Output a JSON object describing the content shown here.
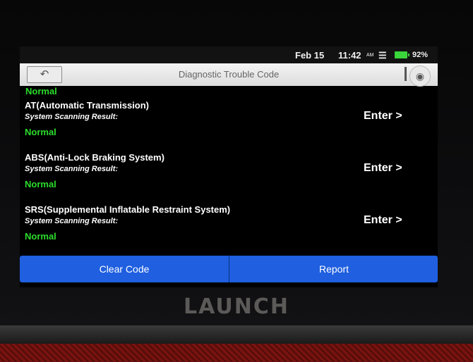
{
  "status_bar": {
    "date": "Feb 15",
    "time": "11:42",
    "ampm": "AM",
    "battery_percent": "92%",
    "wifi_icon": "wifi-icon",
    "battery_icon": "battery-icon",
    "battery_level": 0.92
  },
  "title_bar": {
    "back_icon": "back-arrow-icon",
    "title": "Diagnostic Trouble Code",
    "camera_icon": "camera-icon"
  },
  "lead_status": "Normal",
  "systems": [
    {
      "name": "AT(Automatic Transmission)",
      "scan_label": "System Scanning Result:",
      "result": "Normal",
      "enter_label": "Enter >"
    },
    {
      "name": "ABS(Anti-Lock Braking System)",
      "scan_label": "System Scanning Result:",
      "result": "Normal",
      "enter_label": "Enter >"
    },
    {
      "name": "SRS(Supplemental Inflatable Restraint System)",
      "scan_label": "System Scanning Result:",
      "result": "Normal",
      "enter_label": "Enter >"
    }
  ],
  "actions": {
    "clear_code": "Clear Code",
    "report": "Report"
  },
  "device": {
    "brand": "LAUNCH"
  },
  "colors": {
    "status_ok": "#2bdc2b",
    "action_bar": "#1f5fe0"
  }
}
